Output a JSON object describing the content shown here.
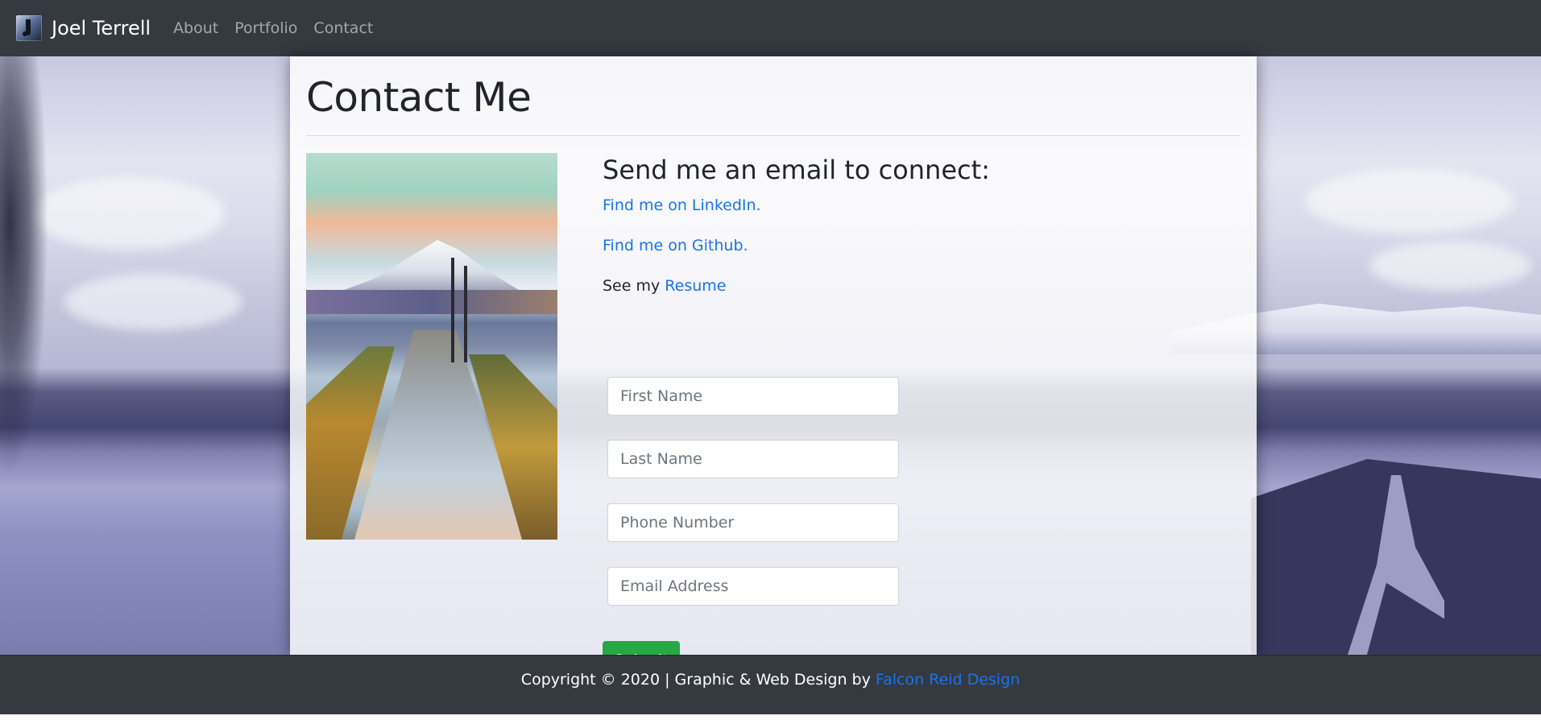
{
  "navbar": {
    "brand": "Joel Terrell",
    "links": [
      "About",
      "Portfolio",
      "Contact"
    ]
  },
  "main": {
    "title": "Contact Me",
    "subtitle": "Send me an email to connect:",
    "linkedin_text": "Find me on LinkedIn.",
    "github_text": "Find me on Github.",
    "resume_prefix": "See my",
    "resume_link": "Resume"
  },
  "form": {
    "first_name_placeholder": "First Name",
    "last_name_placeholder": "Last Name",
    "phone_placeholder": "Phone Number",
    "email_placeholder": "Email Address",
    "submit_label": "Submit"
  },
  "footer": {
    "text": "Copyright © 2020 | Graphic & Web Design by",
    "link": "Falcon Reid Design"
  },
  "colors": {
    "navbar": "#343a40",
    "link": "#1a73e8",
    "submit": "#28a745"
  }
}
